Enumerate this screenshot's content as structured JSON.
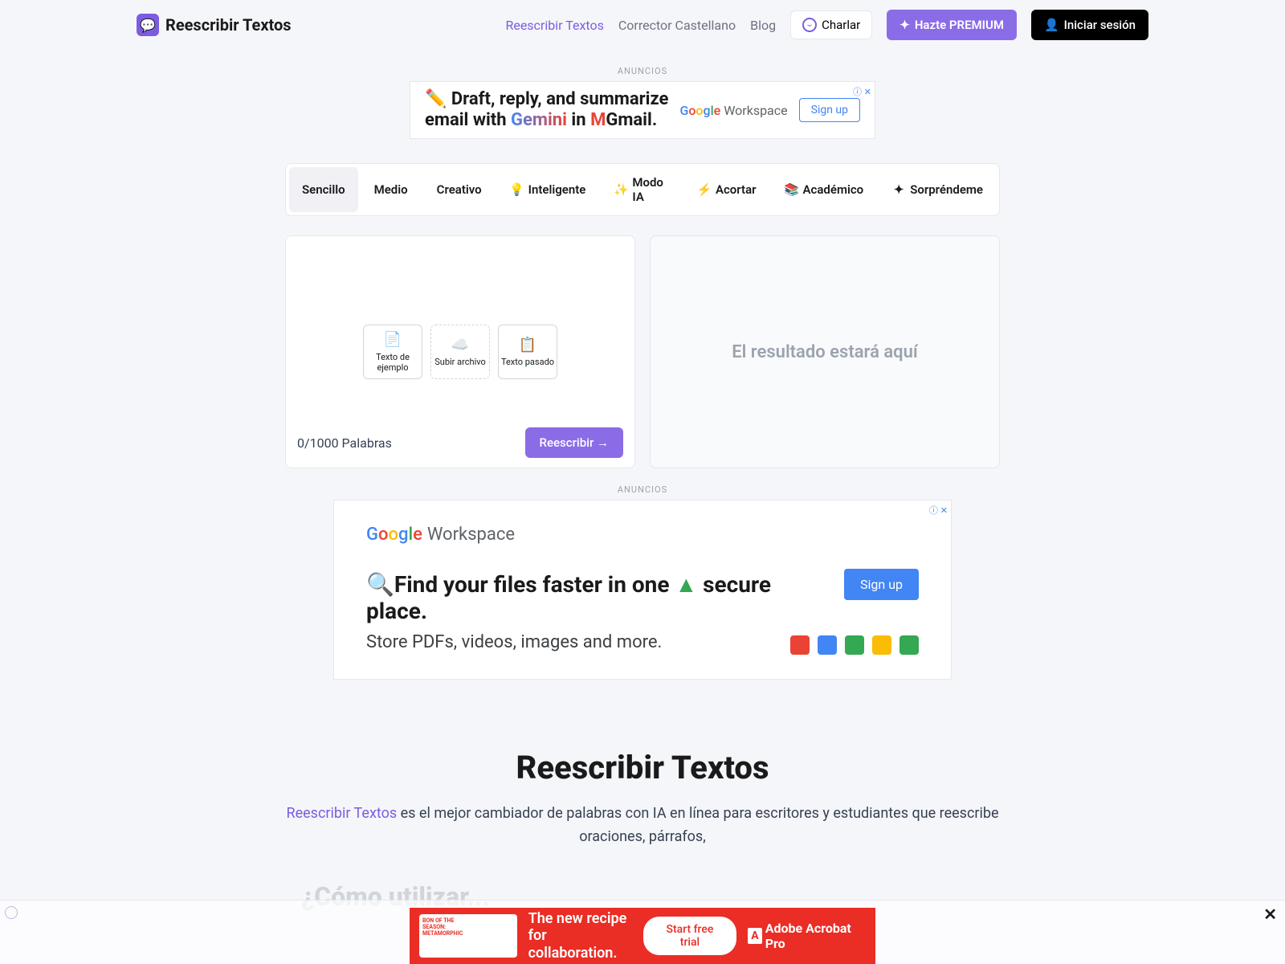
{
  "header": {
    "brand": "Reescribir Textos",
    "nav": {
      "reescribir": "Reescribir Textos",
      "corrector": "Corrector Castellano",
      "blog": "Blog",
      "charlar": "Charlar",
      "premium": "Hazte PREMIUM",
      "login": "Iniciar sesión"
    }
  },
  "ads": {
    "label": "ANUNCIOS",
    "banner1": {
      "line1": "✏️ Draft, reply, and summarize",
      "line2_pre": "email with ",
      "gemini": "Gemini",
      "line2_mid": " in ",
      "gmail": "Gmail",
      "workspace": "Google Workspace",
      "signup": "Sign up"
    },
    "large": {
      "workspace": "Workspace",
      "title_pre": "🔍Find your files faster in one ",
      "title_post": " secure place.",
      "subtitle": "Store PDFs, videos, images and more.",
      "signup": "Sign up"
    },
    "bottom": {
      "tag1": "BON OF THE",
      "tag2": "SEASON:",
      "tag3": "METAMORPHIC",
      "line1": "The new recipe",
      "line2": "for collaboration.",
      "cta": "Start free trial",
      "brand": "Adobe Acrobat Pro"
    }
  },
  "tabs": {
    "sencillo": "Sencillo",
    "medio": "Medio",
    "creativo": "Creativo",
    "inteligente": "Inteligente",
    "modo_ia": "Modo IA",
    "acortar": "Acortar",
    "academico": "Académico",
    "sorprendeme": "Sorpréndeme"
  },
  "editor": {
    "options": {
      "texto_ejemplo": "Texto de ejemplo",
      "subir_archivo": "Subir archivo",
      "texto_pasado": "Texto pasado"
    },
    "word_count": "0/1000 Palabras",
    "rewrite_btn": "Reescribir →",
    "output_placeholder": "El resultado estará aquí"
  },
  "content": {
    "title": "Reescribir Textos",
    "link": "Reescribir Textos",
    "text": " es el mejor cambiador de palabras con IA en línea para escritores y estudiantes que reescribe oraciones, párrafos,",
    "subheading": "¿Cómo utilizar..."
  }
}
